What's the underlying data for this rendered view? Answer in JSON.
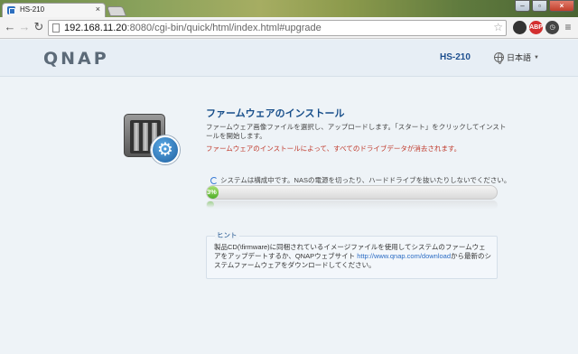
{
  "browser": {
    "tab_title": "HS-210",
    "tab_close": "×",
    "url_host": "192.168.11.20",
    "url_rest": ":8080/cgi-bin/quick/html/index.html#upgrade",
    "window_buttons": {
      "minimize": "–",
      "maximize": "▫",
      "close": "×"
    },
    "extensions": [
      {
        "name": "shield-extension-icon",
        "label": "",
        "color": "#333333"
      },
      {
        "name": "adblock-plus-icon",
        "label": "ABP",
        "color": "#d32f2f"
      },
      {
        "name": "clock-extension-icon",
        "label": "",
        "color": "#444444"
      }
    ]
  },
  "header": {
    "logo": "QNAP",
    "model": "HS-210",
    "language": "日本語"
  },
  "main": {
    "title": "ファームウェアのインストール",
    "description": "ファームウェア画像ファイルを選択し、アップロードします。「スタート」をクリックしてインストールを開始します。",
    "warning": "ファームウェアのインストールによって、すべてのドライブデータが消去されます。",
    "status": "システムは構成中です。NASの電源を切ったり、ハードドライブを抜いたりしないでください。",
    "progress": {
      "percent": 3,
      "label": "3%"
    }
  },
  "hint": {
    "legend": "ヒント",
    "text_before": "製品CD(\\firmware)に同梱されているイメージファイルを使用してシステムのファームウェアをアップデートするか、QNAPウェブサイト ",
    "link": "http://www.qnap.com/download",
    "text_after": "から最新のシステムファームウェアをダウンロードしてください。"
  },
  "colors": {
    "accent": "#174e8a",
    "warning": "#c0392b",
    "progress": "#4fae2a",
    "link": "#2b6cc4"
  }
}
